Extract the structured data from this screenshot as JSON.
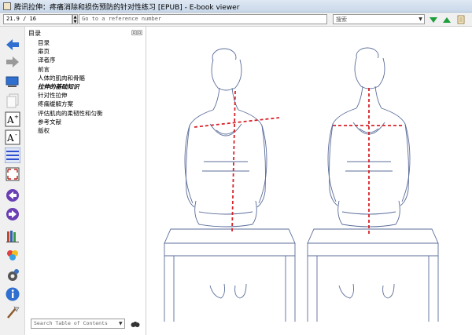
{
  "window": {
    "title": "腾讯拉伸：疼痛消除和损伤预防的针对性练习 [EPUB] - E-book viewer"
  },
  "toolbar": {
    "position": "21.9 / 16",
    "reference_placeholder": "Go to a reference number",
    "search_placeholder": "搜索",
    "icons": [
      "down-arrow-icon",
      "up-arrow-icon",
      "scroll-icon"
    ],
    "accent_green": "#1e9e3a"
  },
  "leftbar": {
    "icons": [
      "back-icon",
      "forward-icon",
      "display-icon",
      "copy-icon",
      "font-larger-icon",
      "font-smaller-icon",
      "toc-icon",
      "fullscreen-icon",
      "previous-page-icon",
      "next-page-icon",
      "library-icon",
      "preferences-icon",
      "settings-icon",
      "info-icon",
      "tools-icon"
    ],
    "accent_blue": "#2f6fd0",
    "accent_purple": "#6a3fb5"
  },
  "toc": {
    "header": "目录",
    "header_buttons": "回回",
    "items": [
      {
        "label": "目录"
      },
      {
        "label": "扉页"
      },
      {
        "label": "译者序"
      },
      {
        "label": "前言"
      },
      {
        "label": "人体的肌肉和骨骼"
      },
      {
        "label": "拉伸的基础知识",
        "active": true
      },
      {
        "label": "针对性拉伸"
      },
      {
        "label": "疼痛缓解方案"
      },
      {
        "label": "评估肌肉的柔韧性和匀衡"
      },
      {
        "label": "参考文献"
      },
      {
        "label": "版权"
      }
    ],
    "search_placeholder": "Search Table of Contents"
  },
  "content": {
    "illustration": "two-seated-women-posture-illustration",
    "line_color": "#d8232a"
  }
}
